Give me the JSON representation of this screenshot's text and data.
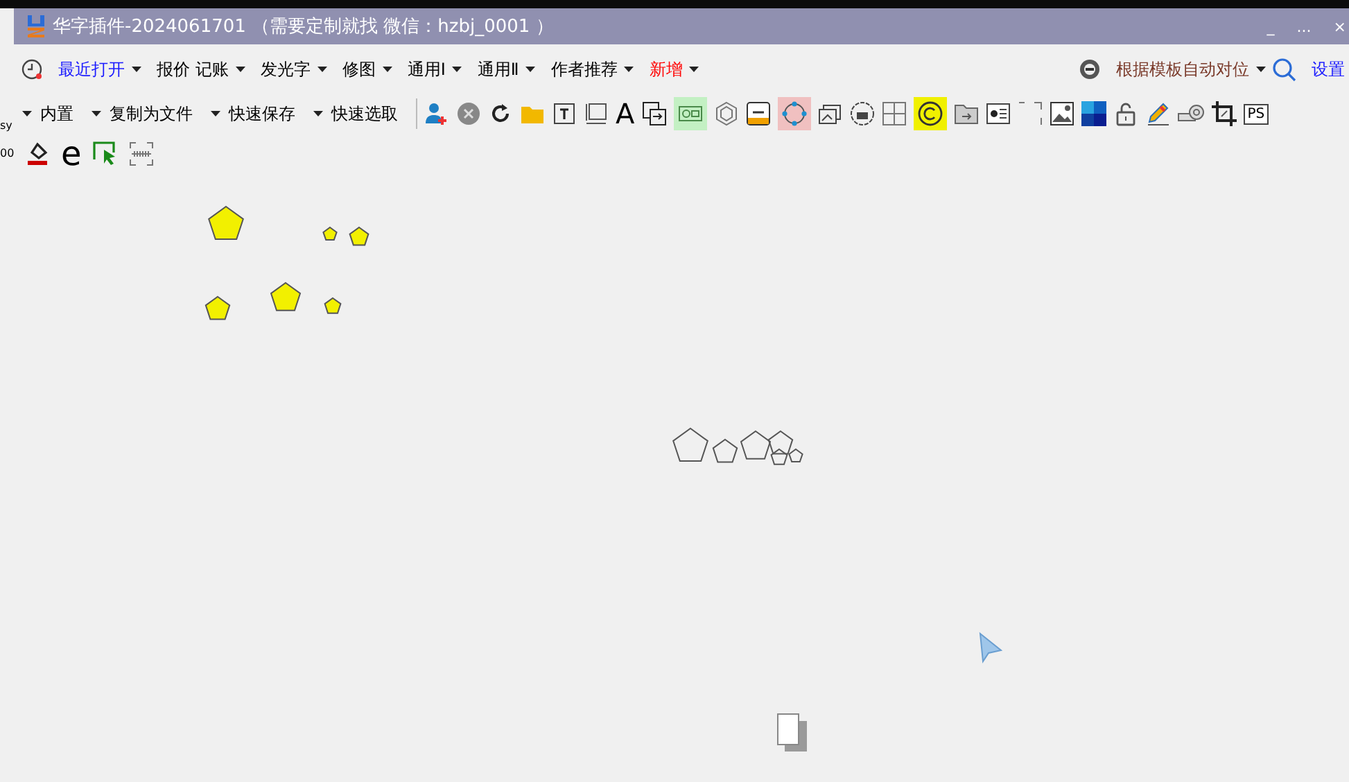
{
  "window": {
    "title": "华字插件-2024061701 （需要定制就找 微信：hzbj_0001 ）",
    "controls": [
      "_",
      "...",
      "×"
    ]
  },
  "left_fragments": [
    "sy",
    "00"
  ],
  "menu": [
    {
      "label": "最近打开",
      "color": "#1a1aff"
    },
    {
      "label": "报价 记账",
      "color": "#000000"
    },
    {
      "label": "发光字",
      "color": "#000000"
    },
    {
      "label": "修图",
      "color": "#000000"
    },
    {
      "label": "通用Ⅰ",
      "color": "#000000"
    },
    {
      "label": "通用Ⅱ",
      "color": "#000000"
    },
    {
      "label": "作者推荐",
      "color": "#000000"
    },
    {
      "label": "新增",
      "color": "#ff0000"
    }
  ],
  "menu_right": {
    "label": "根据模板自动对位",
    "settings": "设置"
  },
  "toolbar": [
    "内置",
    "复制为文件",
    "快速保存",
    "快速选取"
  ],
  "tool_texts": {
    "letter": "A",
    "ps": "PS",
    "e": "e"
  }
}
